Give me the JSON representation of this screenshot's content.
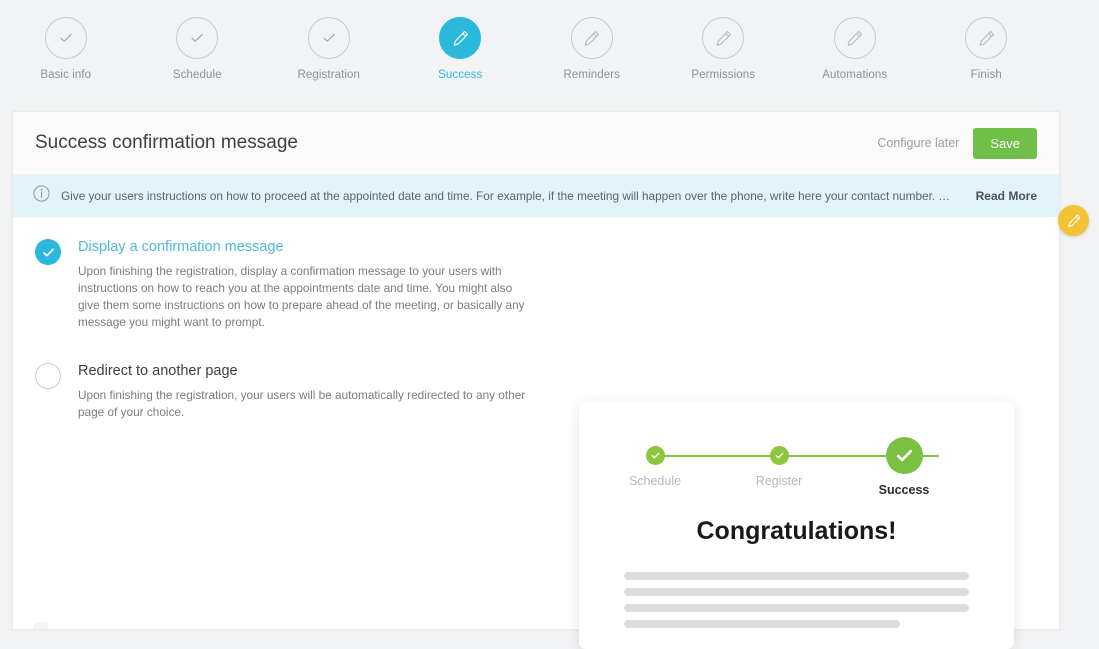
{
  "stepper": {
    "steps": [
      {
        "label": "Basic info",
        "icon": "check-icon",
        "state": "done"
      },
      {
        "label": "Schedule",
        "icon": "check-icon",
        "state": "done"
      },
      {
        "label": "Registration",
        "icon": "check-icon",
        "state": "done"
      },
      {
        "label": "Success",
        "icon": "pencil-icon",
        "state": "active"
      },
      {
        "label": "Reminders",
        "icon": "pencil-icon",
        "state": "pending"
      },
      {
        "label": "Permissions",
        "icon": "pencil-icon",
        "state": "pending"
      },
      {
        "label": "Automations",
        "icon": "pencil-icon",
        "state": "pending"
      },
      {
        "label": "Finish",
        "icon": "pencil-icon",
        "state": "pending"
      }
    ]
  },
  "header": {
    "title": "Success confirmation message",
    "configure_later_label": "Configure later",
    "save_label": "Save"
  },
  "edit_badge": {
    "icon": "pencil-icon"
  },
  "banner": {
    "icon": "info-icon",
    "text": "Give your users instructions on how to proceed at the appointed date and time. For example, if the meeting will happen over the phone, write here your contact number. You might a...",
    "read_more_label": "Read More"
  },
  "options": [
    {
      "title": "Display a confirmation message",
      "description": "Upon finishing the registration, display a confirmation message to your users with instructions on how to reach you at the appointments date and time. You might also give them some instructions on how to prepare ahead of the meeting, or basically any message you might want to prompt.",
      "selected": true
    },
    {
      "title": "Redirect to another page",
      "description": "Upon finishing the registration, your users will be automatically redirected to any other page of your choice.",
      "selected": false
    }
  ],
  "preview": {
    "steps": [
      {
        "label": "Schedule",
        "state": "done"
      },
      {
        "label": "Register",
        "state": "done"
      },
      {
        "label": "Success",
        "state": "current"
      }
    ],
    "heading": "Congratulations!",
    "placeholder_lines": 4
  },
  "colors": {
    "accent_cyan": "#2bb8dd",
    "save_green": "#6fbf49",
    "preview_green": "#8dc63f",
    "badge_yellow": "#f2c335",
    "banner_blue": "#e3f3fa",
    "page_bg": "#f2f3f4"
  }
}
